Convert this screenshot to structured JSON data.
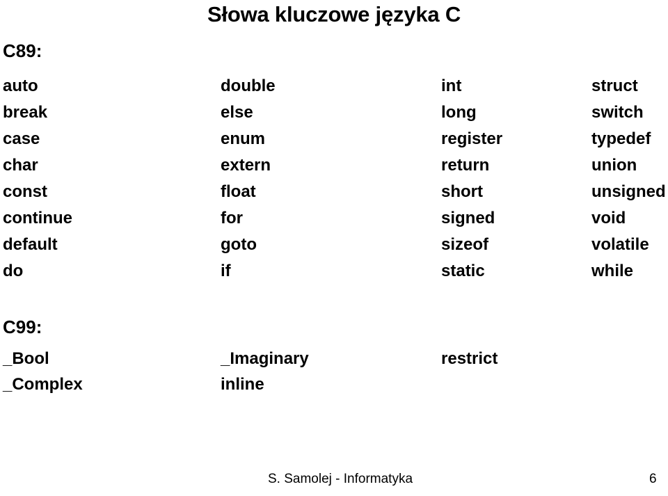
{
  "slide": {
    "title": "Słowa kluczowe języka C",
    "background_color": "#ffffff",
    "text_color": "#000000"
  },
  "c89": {
    "heading": "C89:",
    "columns": 4,
    "rows": [
      [
        "auto",
        "double",
        "int",
        "struct"
      ],
      [
        "break",
        "else",
        "long",
        "switch"
      ],
      [
        "case",
        "enum",
        "register",
        "typedef"
      ],
      [
        "char",
        "extern",
        "return",
        "union"
      ],
      [
        "const",
        "float",
        "short",
        "unsigned"
      ],
      [
        "continue",
        "for",
        "signed",
        "void"
      ],
      [
        "default",
        "goto",
        "sizeof",
        "volatile"
      ],
      [
        "do",
        "if",
        "static",
        "while"
      ]
    ]
  },
  "c99": {
    "heading": "C99:",
    "columns": 4,
    "rows": [
      [
        "_Bool",
        "_Imaginary",
        "restrict",
        ""
      ],
      [
        "_Complex",
        "inline",
        "",
        ""
      ]
    ]
  },
  "footer": {
    "text": "S. Samolej - Informatyka",
    "page_number": "6"
  }
}
